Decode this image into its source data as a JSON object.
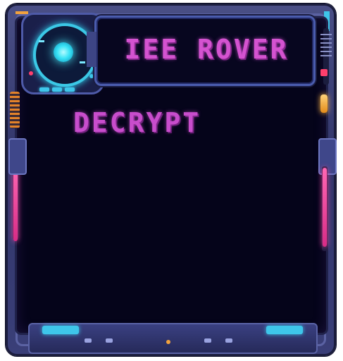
{
  "hud": {
    "title": "IEE ROVER",
    "subtitle": "DECRYPT"
  },
  "colors": {
    "text_magenta": "#d453d0",
    "accent_cyan": "#3ec6ea",
    "accent_pink": "#ff4aa8",
    "frame_blue": "#3a4081",
    "screen_bg": "#05041a"
  },
  "icons": [
    "radar-icon",
    "status-led-icon",
    "vent-icon"
  ]
}
